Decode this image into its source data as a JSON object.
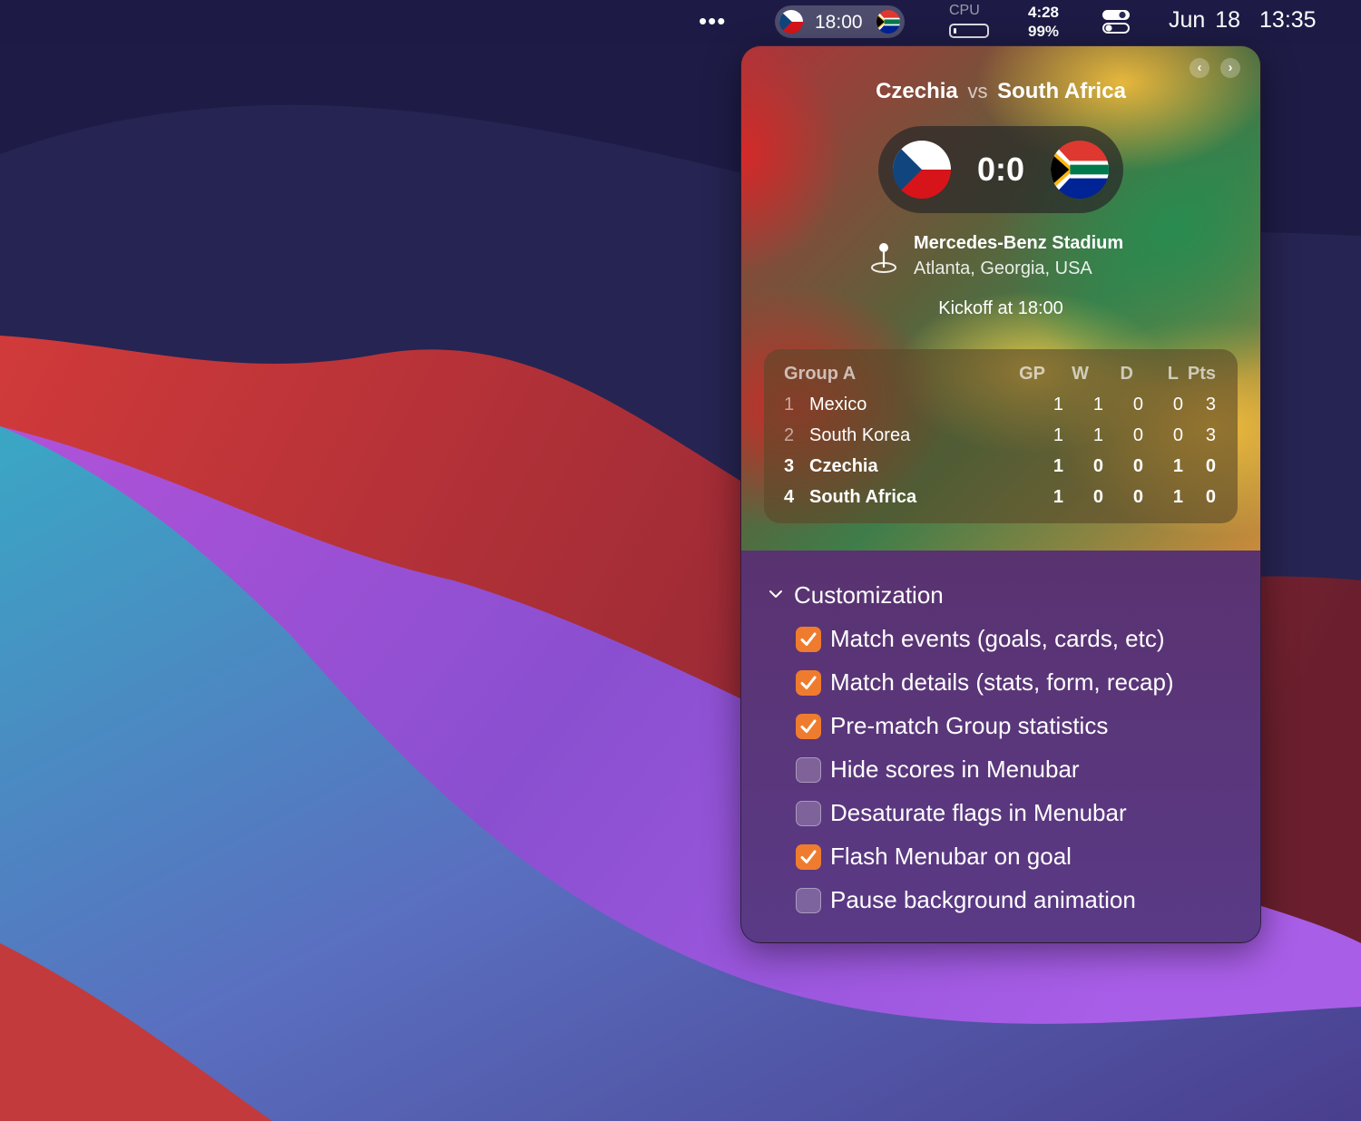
{
  "menubar": {
    "more_glyph": "•••",
    "match_time": "18:00",
    "cpu_label": "CPU",
    "battery_time": "4:28",
    "battery_percent": "99%",
    "date": "Jun 18",
    "clock": "13:35"
  },
  "popover": {
    "home_team": "Czechia",
    "vs": "vs",
    "away_team": "South Africa",
    "score": "0:0",
    "venue_name": "Mercedes-Benz Stadium",
    "venue_location": "Atlanta, Georgia, USA",
    "kickoff": "Kickoff at 18:00",
    "nav": {
      "prev_glyph": "‹",
      "next_glyph": "›"
    },
    "group_table": {
      "title": "Group A",
      "headers": {
        "gp": "GP",
        "w": "W",
        "d": "D",
        "l": "L",
        "pts": "Pts"
      },
      "rows": [
        {
          "rank": "1",
          "team": "Mexico",
          "gp": "1",
          "w": "1",
          "d": "0",
          "l": "0",
          "pts": "3"
        },
        {
          "rank": "2",
          "team": "South Korea",
          "gp": "1",
          "w": "1",
          "d": "0",
          "l": "0",
          "pts": "3"
        },
        {
          "rank": "3",
          "team": "Czechia",
          "gp": "1",
          "w": "0",
          "d": "0",
          "l": "1",
          "pts": "0"
        },
        {
          "rank": "4",
          "team": "South Africa",
          "gp": "1",
          "w": "0",
          "d": "0",
          "l": "1",
          "pts": "0"
        }
      ]
    },
    "customization": {
      "title": "Customization",
      "options": [
        {
          "label": "Match events (goals, cards, etc)",
          "checked": true
        },
        {
          "label": "Match details (stats, form, recap)",
          "checked": true
        },
        {
          "label": "Pre-match Group statistics",
          "checked": true
        },
        {
          "label": "Hide scores in Menubar",
          "checked": false
        },
        {
          "label": "Desaturate flags in Menubar",
          "checked": false
        },
        {
          "label": "Flash Menubar on goal",
          "checked": true
        },
        {
          "label": "Pause background animation",
          "checked": false
        }
      ]
    }
  },
  "colors": {
    "checkbox_on": "#ef7c2e",
    "czech_blue": "#11457e",
    "czech_red": "#d7141a",
    "sa_green": "#007a4d",
    "sa_gold": "#ffb612",
    "sa_red": "#de3831",
    "sa_blue": "#002395"
  }
}
